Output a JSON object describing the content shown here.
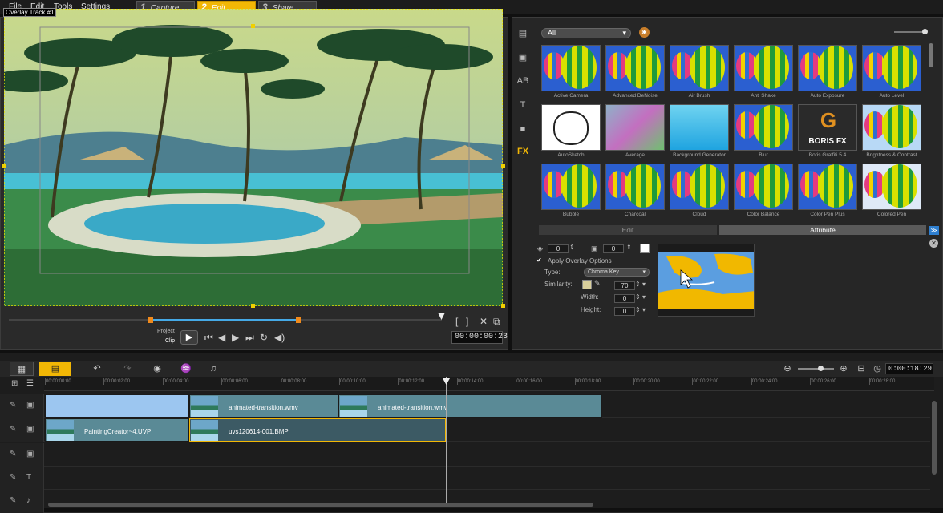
{
  "menu": [
    "File",
    "Edit",
    "Tools",
    "Settings"
  ],
  "steps": [
    {
      "num": "1",
      "label": "Capture"
    },
    {
      "num": "2",
      "label": "Edit"
    },
    {
      "num": "3",
      "label": "Share"
    }
  ],
  "preview": {
    "overlay_label": "Overlay Track #1",
    "mode_project": "Project",
    "mode_clip": "Clip",
    "timecode": "00:00:00:23",
    "trim_in": 0.31,
    "trim_out": 0.67
  },
  "library": {
    "filter": "All",
    "tools": [
      "media-icon",
      "instant-project-icon",
      "transition-icon",
      "title-icon",
      "graphic-icon",
      "fx-icon"
    ],
    "fx_label": "FX",
    "effects": [
      "Active Camera",
      "Advanced DeNoise",
      "Air Brush",
      "Anti Shake",
      "Auto Exposure",
      "Auto Level",
      "AutoSketch",
      "Average",
      "Background Generator",
      "Blur",
      "Boris Graffiti 5.4",
      "Brightness & Contrast",
      "Bubble",
      "Charcoal",
      "Cloud",
      "Color Balance",
      "Color Pen Plus",
      "Colored Pen"
    ],
    "boris_logo": "BORIS FX",
    "tabs": {
      "edit": "Edit",
      "attribute": "Attribute"
    }
  },
  "attribute": {
    "offset_value": "0",
    "size_value": "0",
    "apply_overlay_options": "Apply Overlay Options",
    "type_label": "Type:",
    "type_value": "Chroma Key",
    "similarity_label": "Similarity:",
    "similarity_value": "70",
    "width_label": "Width:",
    "width_value": "0",
    "height_label": "Height:",
    "height_value": "0",
    "key_color": "#d9cf9c"
  },
  "timeline": {
    "timecode": "0:00:18:29",
    "ruler": [
      "00:00:00:00",
      "00:00:02:00",
      "00:00:04:00",
      "00:00:06:00",
      "00:00:08:00",
      "00:00:10:00",
      "00:00:12:00",
      "00:00:14:00",
      "00:00:16:00",
      "00:00:18:00",
      "00:00:20:00",
      "00:00:22:00",
      "00:00:24:00",
      "00:00:26:00",
      "00:00:28:00"
    ],
    "tracks": [
      {
        "icon": "video-track-icon",
        "clips": [
          {
            "name": "animated-transition.wmv"
          },
          {
            "name": "animated-transition.wmv"
          }
        ]
      },
      {
        "icon": "overlay-track-icon",
        "clips": [
          {
            "name": "PaintingCreator~4.UVP"
          },
          {
            "name": "uvs120614-001.BMP"
          }
        ]
      },
      {
        "icon": "overlay2-track-icon",
        "clips": []
      },
      {
        "icon": "title-track-icon",
        "clips": []
      },
      {
        "icon": "voice-track-icon",
        "clips": []
      }
    ]
  }
}
